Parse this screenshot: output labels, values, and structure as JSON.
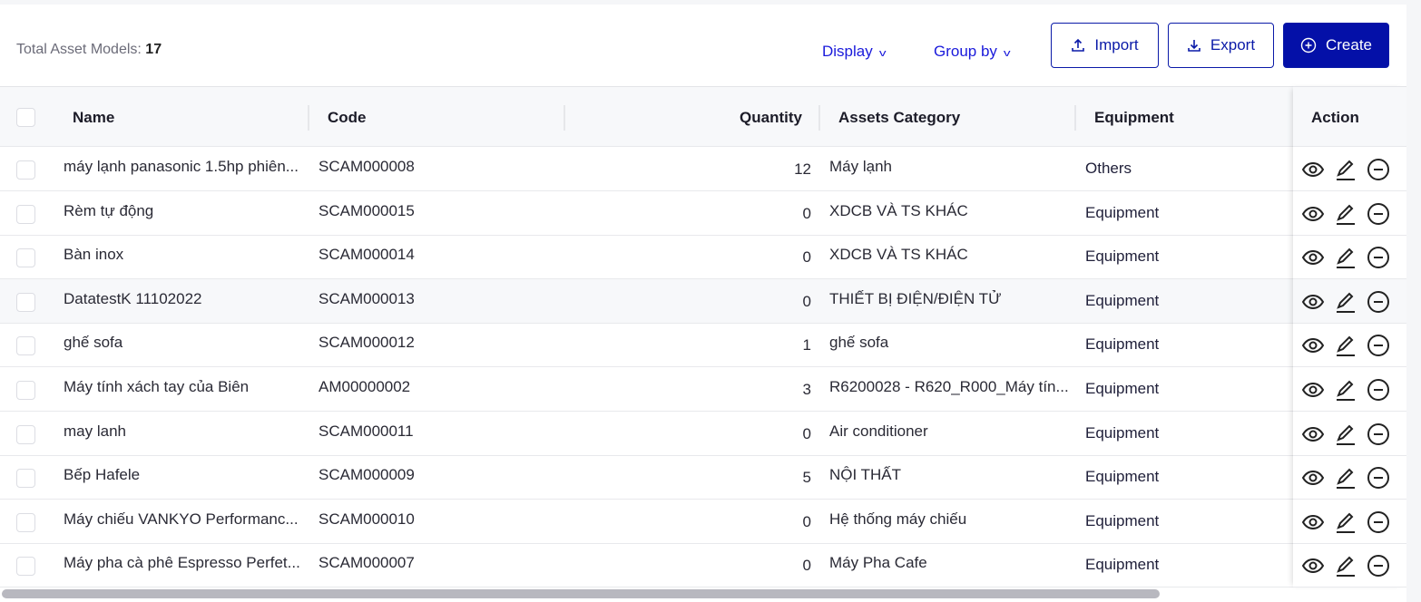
{
  "header": {
    "total_label": "Total Asset Models:",
    "total_count": "17",
    "display": "Display",
    "group_by": "Group by",
    "import": "Import",
    "export": "Export",
    "create": "Create"
  },
  "columns": {
    "name": "Name",
    "code": "Code",
    "quantity": "Quantity",
    "category": "Assets Category",
    "equipment": "Equipment",
    "action": "Action"
  },
  "rows": [
    {
      "name": "máy lạnh panasonic 1.5hp phiên...",
      "code": "SCAM000008",
      "quantity": "12",
      "category": "Máy lạnh",
      "equipment": "Others"
    },
    {
      "name": "Rèm tự động",
      "code": "SCAM000015",
      "quantity": "0",
      "category": "XDCB VÀ TS KHÁC",
      "equipment": "Equipment"
    },
    {
      "name": "Bàn inox",
      "code": "SCAM000014",
      "quantity": "0",
      "category": "XDCB VÀ TS KHÁC",
      "equipment": "Equipment"
    },
    {
      "name": "DatatestK 11102022",
      "code": "SCAM000013",
      "quantity": "0",
      "category": "THIẾT BỊ ĐIỆN/ĐIỆN TỬ",
      "equipment": "Equipment"
    },
    {
      "name": "ghế sofa",
      "code": "SCAM000012",
      "quantity": "1",
      "category": "ghế sofa",
      "equipment": "Equipment"
    },
    {
      "name": "Máy tính xách tay của Biên",
      "code": "AM00000002",
      "quantity": "3",
      "category": "R6200028 - R620_R000_Máy tín...",
      "equipment": "Equipment"
    },
    {
      "name": "may lanh",
      "code": "SCAM000011",
      "quantity": "0",
      "category": "Air conditioner",
      "equipment": "Equipment"
    },
    {
      "name": "Bếp Hafele",
      "code": "SCAM000009",
      "quantity": "5",
      "category": "NỘI THẤT",
      "equipment": "Equipment"
    },
    {
      "name": "Máy chiếu VANKYO Performanc...",
      "code": "SCAM000010",
      "quantity": "0",
      "category": "Hệ thống máy chiếu",
      "equipment": "Equipment"
    },
    {
      "name": "Máy pha cà phê Espresso Perfet...",
      "code": "SCAM000007",
      "quantity": "0",
      "category": "Máy Pha Cafe",
      "equipment": "Equipment"
    }
  ]
}
